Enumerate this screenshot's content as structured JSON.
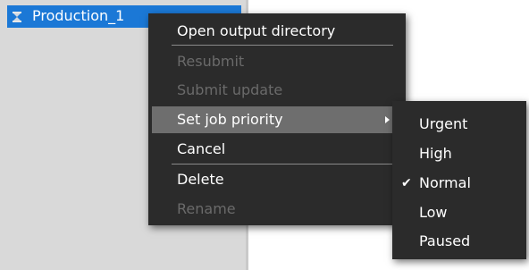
{
  "job_list": {
    "job_name": "Production_1",
    "job_icon": "hourglass-icon",
    "selection_color": "#1b78d6"
  },
  "context_menu": {
    "items": [
      {
        "label": "Open output directory",
        "enabled": true
      },
      {
        "label": "Resubmit",
        "enabled": false
      },
      {
        "label": "Submit update",
        "enabled": false
      },
      {
        "label": "Set job priority",
        "enabled": true,
        "highlighted": true,
        "has_submenu": true
      },
      {
        "label": "Cancel",
        "enabled": true
      },
      {
        "label": "Delete",
        "enabled": true
      },
      {
        "label": "Rename",
        "enabled": false
      }
    ],
    "background_color": "#2b2b2b",
    "highlight_color": "#6e6e6e",
    "disabled_color": "#6a6a6a"
  },
  "priority_submenu": {
    "items": [
      {
        "label": "Urgent",
        "checked": false
      },
      {
        "label": "High",
        "checked": false
      },
      {
        "label": "Normal",
        "checked": true
      },
      {
        "label": "Low",
        "checked": false
      },
      {
        "label": "Paused",
        "checked": false
      }
    ],
    "check_glyph": "✔"
  }
}
